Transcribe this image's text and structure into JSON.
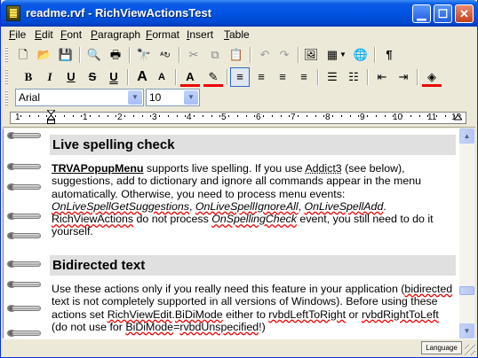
{
  "window": {
    "title": "readme.rvf - RichViewActionsTest"
  },
  "menu": [
    {
      "label": "File",
      "u": "F",
      "rest": "ile"
    },
    {
      "label": "Edit",
      "u": "E",
      "rest": "dit"
    },
    {
      "label": "Font",
      "u": "F",
      "rest": "ont"
    },
    {
      "label": "Paragraph",
      "u": "P",
      "rest": "aragraph"
    },
    {
      "label": "Format",
      "u": "F",
      "rest": "ormat"
    },
    {
      "label": "Insert",
      "u": "I",
      "rest": "nsert"
    },
    {
      "label": "Table",
      "u": "T",
      "rest": "able"
    }
  ],
  "toolbar1": {
    "icons": [
      "new-icon",
      "open-icon",
      "save-icon",
      "print-preview-icon",
      "print-icon",
      "find-icon",
      "replace-icon",
      "cut-icon",
      "copy-icon",
      "paste-icon",
      "undo-icon",
      "redo-icon",
      "insert-picture-icon",
      "insert-table-icon",
      "insert-hyperlink-icon",
      "show-special-characters-icon"
    ],
    "glyphs": [
      "🗋",
      "📂",
      "💾",
      "🔍",
      "🖶",
      "🔭",
      "ᴬ↻",
      "✂",
      "⧉",
      "📋",
      "↶",
      "↷",
      "🖼",
      "▦",
      "🌐",
      "¶"
    ]
  },
  "toolbar2": {
    "bold": "B",
    "italic": "I",
    "underline": "U",
    "strike": "S",
    "underline_double": "U",
    "grow": "A",
    "shrink": "A",
    "font_color": "A",
    "highlight": "✎",
    "align_glyphs": [
      "≡",
      "≡",
      "≡",
      "≡"
    ],
    "list_glyphs": [
      "☰",
      "☷"
    ],
    "indent_glyphs": [
      "⇤",
      "⇥"
    ],
    "fill_glyph": "◈"
  },
  "toolbar3": {
    "font_name": "Arial",
    "font_size": "10"
  },
  "ruler": {
    "numbers": [
      "1",
      "1",
      "2",
      "3",
      "4",
      "5",
      "6",
      "7",
      "8",
      "9",
      "10",
      "11",
      "12"
    ]
  },
  "document": {
    "heading1": "Live spelling check",
    "para1": {
      "t1": "TRVAPopupMenu",
      "t2": " supports live spelling. If you use ",
      "t3": "Addict3",
      "t4": " (see below), suggestions, add to dictionary and ignore all commands appear in the menu automatically. Otherwise, you need to process menu events: ",
      "t5": "OnLiveSpellGetSuggestions",
      "t6": ", ",
      "t7": "OnLiveSpellIgnoreAll",
      "t8": ", ",
      "t9": "OnLiveSpellAdd",
      "t10": ". ",
      "t11": "RichViewActions",
      "t12": " do not process ",
      "t13": "OnSpellingCheck",
      "t14": " event, you still need to do it yourself."
    },
    "heading2": "Bidirected text",
    "para2": {
      "t1": "Use these actions only if you really need this feature in your application (",
      "t2": "bidirected",
      "t3": " text is not completely supported in all versions of Windows). Before using these actions set ",
      "t4": "RichViewEdit",
      "t5": ".",
      "t6": "BiDiMode",
      "t7": " either to ",
      "t8": "rvbdLeftToRight",
      "t9": " or ",
      "t10": "rvbdRightToLeft",
      "t11": " (do not use for ",
      "t12": "BiDiMode",
      "t13": "=",
      "t14": "rvbdUnspecified",
      "t15": "!)"
    }
  },
  "status": {
    "language_button": "Language"
  }
}
